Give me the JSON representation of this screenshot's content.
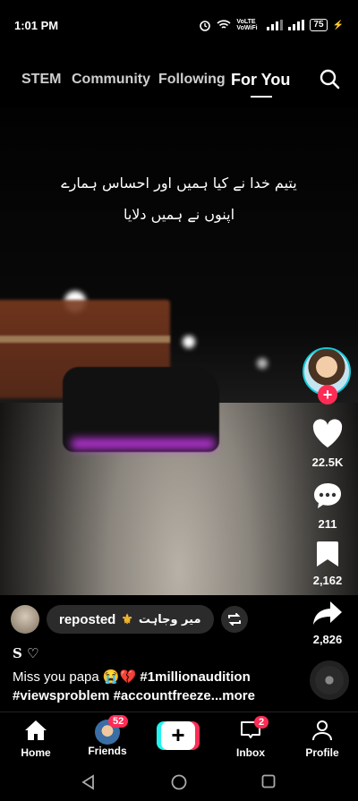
{
  "status_bar": {
    "time": "1:01 PM",
    "network_label": "VoLTE VoWiFi",
    "battery": "75"
  },
  "top_tabs": [
    {
      "label": "STEM"
    },
    {
      "label": "Community"
    },
    {
      "label": "Following"
    },
    {
      "label": "For You",
      "active": true
    }
  ],
  "video": {
    "overlay_line1": "یتیم خدا نے کیا ہمیں اور احساس ہمارے",
    "overlay_line2": "اپنوں نے ہمیں دلایا"
  },
  "actions": {
    "likes": "22.5K",
    "comments": "211",
    "saves": "2,162",
    "shares": "2,826"
  },
  "repost": {
    "label": "reposted",
    "user": "میر وجاہت"
  },
  "post": {
    "author": "S ♡",
    "caption_text": "Miss you papa 😭💔",
    "hashtag1": "#1millionaudition",
    "hashtag2": "#viewsproblem",
    "hashtag3": "#accountfreeze",
    "more": "...more"
  },
  "bottom_nav": {
    "home": "Home",
    "friends": "Friends",
    "friends_badge": "52",
    "inbox": "Inbox",
    "inbox_badge": "2",
    "profile": "Profile"
  },
  "colors": {
    "accent": "#fe2c55",
    "cyan": "#25f4ee"
  }
}
